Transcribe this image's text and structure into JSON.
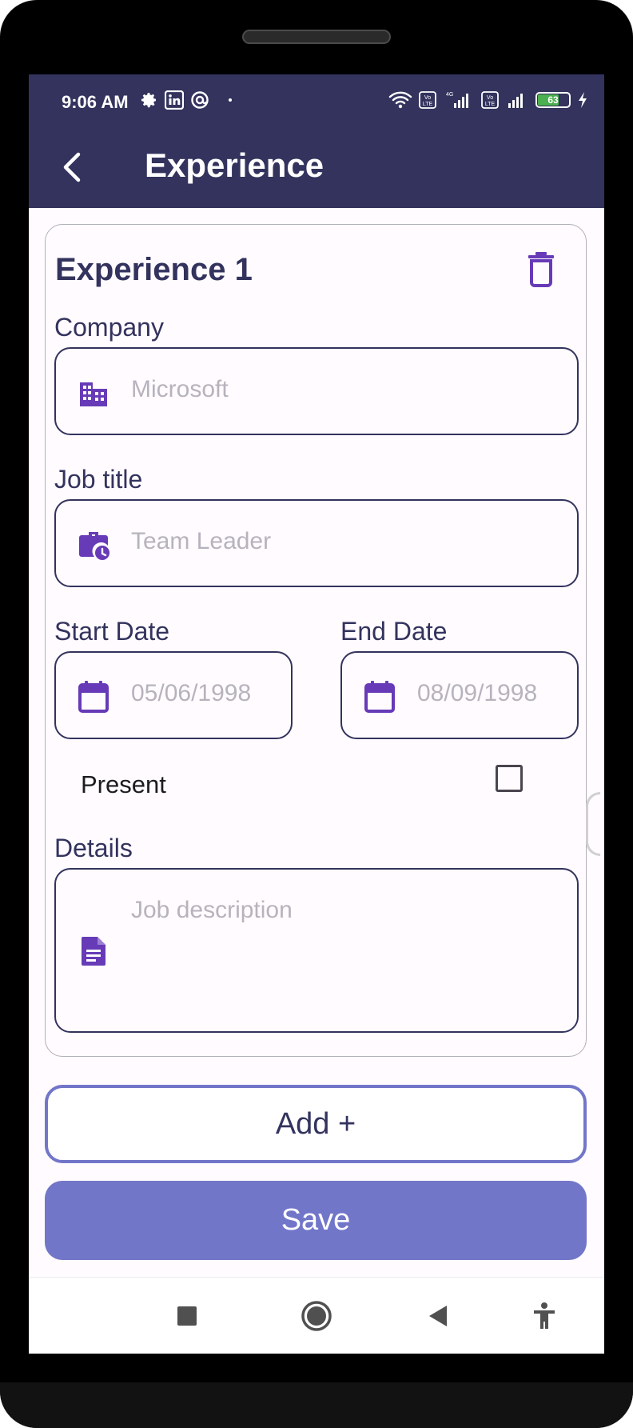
{
  "status_bar": {
    "time": "9:06 AM",
    "battery": "63"
  },
  "app_bar": {
    "title": "Experience"
  },
  "experience": {
    "title": "Experience 1",
    "company": {
      "label": "Company",
      "placeholder": "Microsoft",
      "icon": "building-icon"
    },
    "job_title": {
      "label": "Job title",
      "placeholder": "Team Leader",
      "icon": "work-history-icon"
    },
    "start_date": {
      "label": "Start Date",
      "placeholder": "05/06/1998",
      "icon": "calendar-icon"
    },
    "end_date": {
      "label": "End Date",
      "placeholder": "08/09/1998",
      "icon": "calendar-icon"
    },
    "present": {
      "label": "Present",
      "checked": false
    },
    "details": {
      "label": "Details",
      "placeholder": "Job description",
      "icon": "document-icon"
    }
  },
  "actions": {
    "add_label": "Add +",
    "save_label": "Save"
  },
  "colors": {
    "app_bar": "#33335e",
    "accent": "#673ab7",
    "button": "#7276c9"
  }
}
